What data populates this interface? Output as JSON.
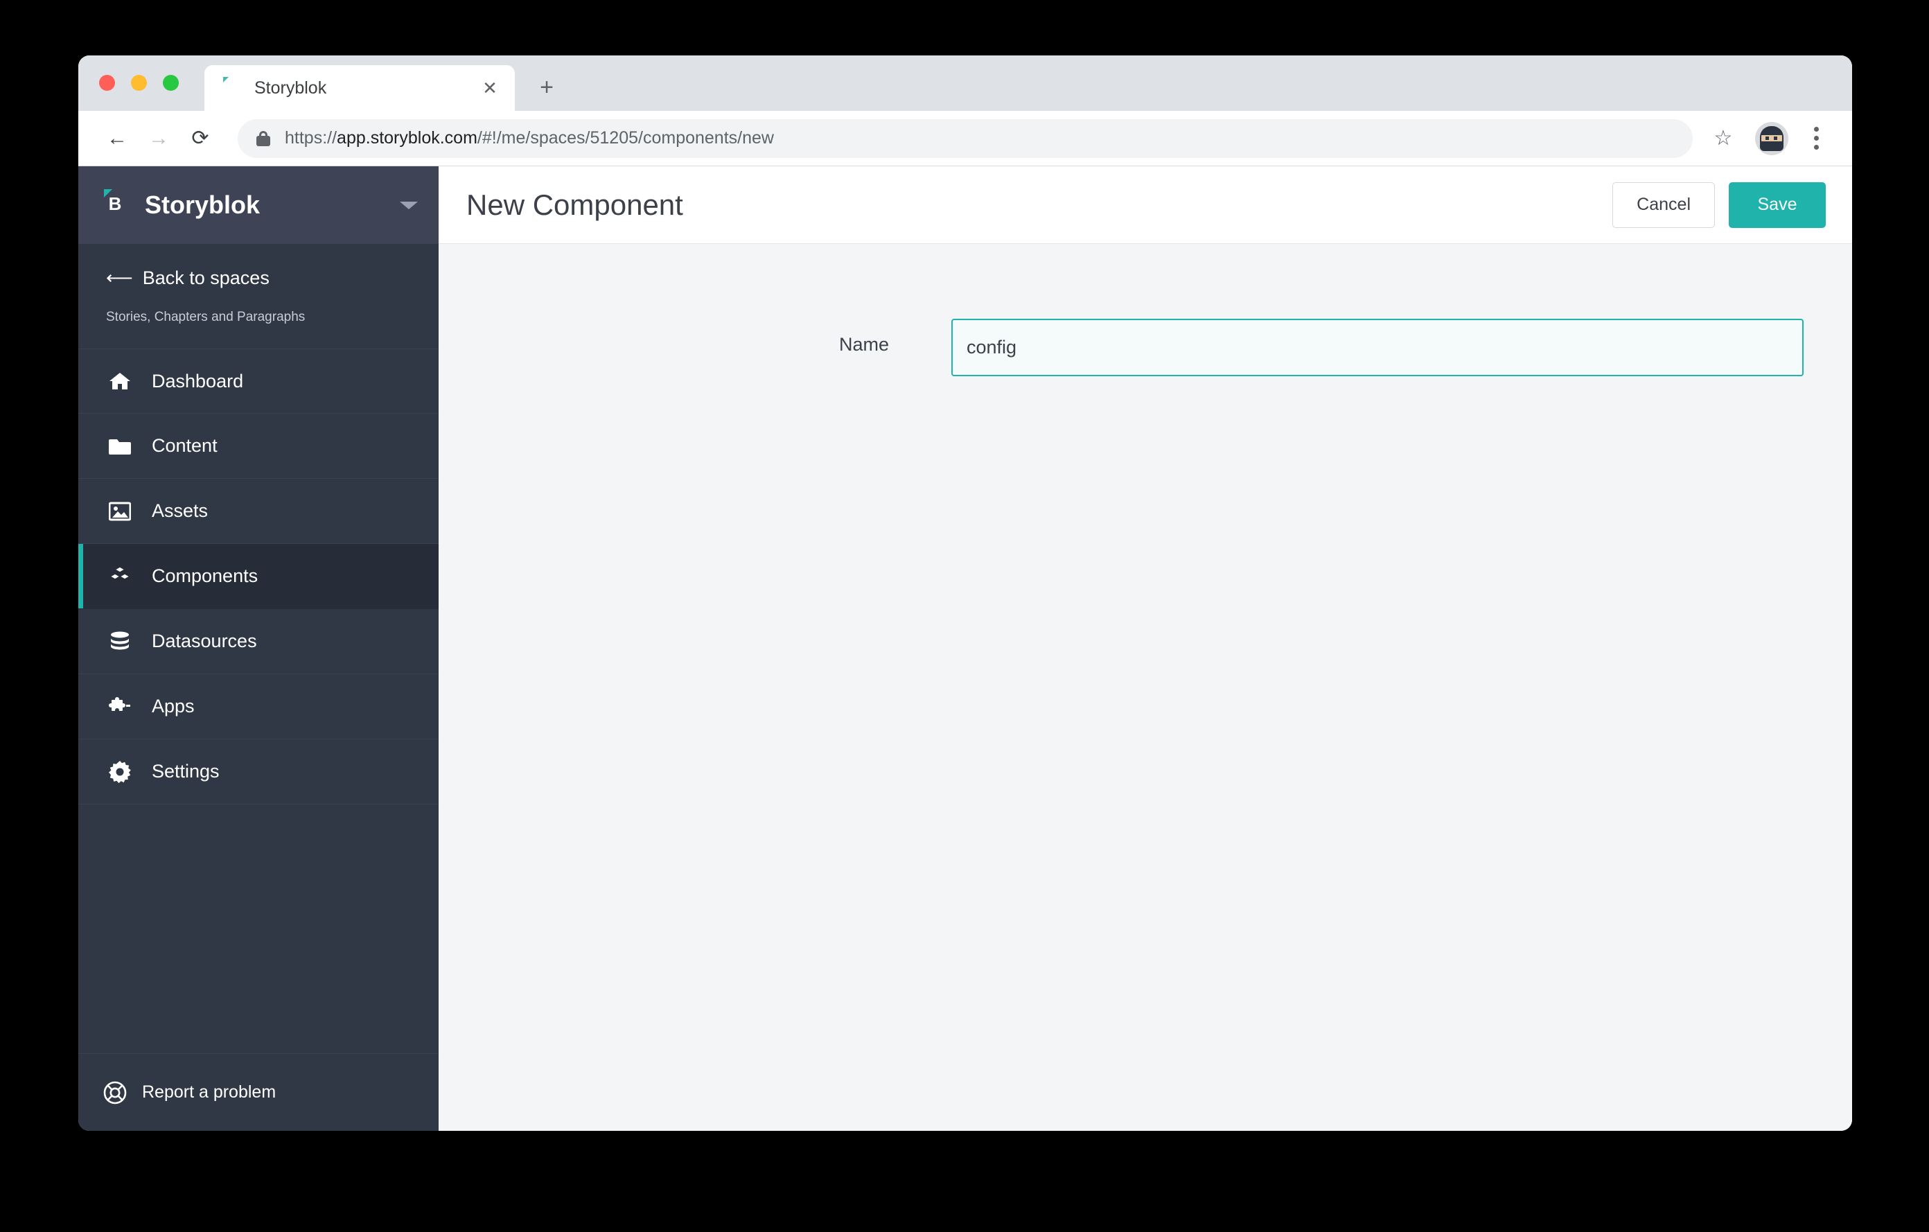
{
  "browser": {
    "tab": {
      "title": "Storyblok",
      "favicon_icon": "storyblok-favicon",
      "close_icon": "close-icon"
    },
    "new_tab_label": "+",
    "nav": {
      "back_icon": "arrow-left-icon",
      "forward_icon": "arrow-right-icon",
      "reload_icon": "reload-icon"
    },
    "omnibox": {
      "lock_icon": "lock-icon",
      "url_scheme": "https://",
      "url_host": "app.storyblok.com",
      "url_path": "/#!/me/spaces/51205/components/new",
      "url_full": "https://app.storyblok.com/#!/me/spaces/51205/components/new"
    },
    "actions": {
      "bookmark_icon": "star-icon",
      "profile_icon": "ninja-avatar-icon",
      "menu_icon": "three-dots-menu-icon"
    }
  },
  "sidebar": {
    "brand": "Storyblok",
    "brand_logo_icon": "storyblok-logo-icon",
    "space_dropdown_icon": "chevron-down-icon",
    "back_link": {
      "label": "Back to spaces",
      "icon": "arrow-left-icon"
    },
    "space_description": "Stories, Chapters and Paragraphs",
    "items": [
      {
        "label": "Dashboard",
        "icon": "home-icon",
        "active": false
      },
      {
        "label": "Content",
        "icon": "folder-icon",
        "active": false
      },
      {
        "label": "Assets",
        "icon": "image-icon",
        "active": false
      },
      {
        "label": "Components",
        "icon": "blocks-icon",
        "active": true
      },
      {
        "label": "Datasources",
        "icon": "database-icon",
        "active": false
      },
      {
        "label": "Apps",
        "icon": "puzzle-icon",
        "active": false
      },
      {
        "label": "Settings",
        "icon": "gear-icon",
        "active": false
      }
    ],
    "footer": {
      "label": "Report a problem",
      "icon": "lifebuoy-icon"
    }
  },
  "header": {
    "title": "New Component",
    "cancel_label": "Cancel",
    "save_label": "Save"
  },
  "form": {
    "name_label": "Name",
    "name_value": "config",
    "name_placeholder": ""
  },
  "colors": {
    "accent_teal": "#1fb3ab",
    "sidebar_bg": "#303745",
    "sidebar_header_bg": "#3e4455",
    "sidebar_active_bg": "#262c38",
    "content_bg": "#f4f5f7"
  }
}
